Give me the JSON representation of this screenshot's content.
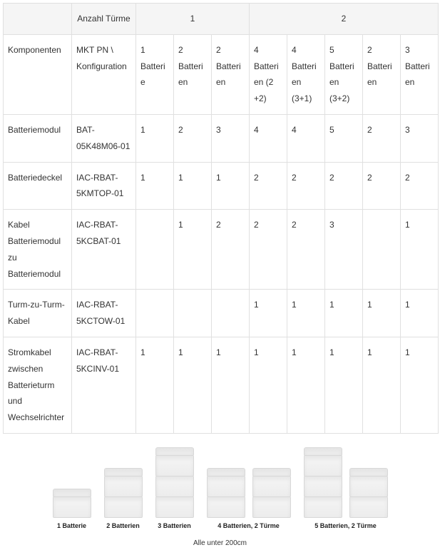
{
  "header": {
    "towers_label": "Anzahl Türme",
    "group1": "1",
    "group2": "2"
  },
  "col_labels": {
    "c0": "Komponenten",
    "c1": "MKT PN \\ Konfiguration",
    "c2": "1 Batterie",
    "c3": "2 Batterien",
    "c4": "2 Batterien",
    "c5": "4 Batterien (2 +2)",
    "c6": "4 Batterien (3+1)",
    "c7": "5 Batterien (3+2)",
    "c8": "2 Batterien",
    "c9": "3 Batterien"
  },
  "rows": [
    {
      "label": "Batteriemodul",
      "mkt": "BAT-05K48M06-01",
      "v": [
        "1",
        "2",
        "3",
        "4",
        "4",
        "5",
        "2",
        "3"
      ]
    },
    {
      "label": "Batteriedeckel",
      "mkt": "IAC-RBAT-5KMTOP-01",
      "v": [
        "1",
        "1",
        "1",
        "2",
        "2",
        "2",
        "2",
        "2"
      ]
    },
    {
      "label": "Kabel Batteriemodul zu Batteriemodul",
      "mkt": "IAC-RBAT-5KCBAT-01",
      "v": [
        "",
        "1",
        "2",
        "2",
        "2",
        "3",
        "",
        "1"
      ]
    },
    {
      "label": "Turm-zu-Turm-Kabel",
      "mkt": "IAC-RBAT-5KCTOW-01",
      "v": [
        "",
        "",
        "",
        "1",
        "1",
        "1",
        "1",
        "1"
      ]
    },
    {
      "label": "Stromkabel zwischen Batterieturm und Wechselrichter",
      "mkt": "IAC-RBAT-5KCINV-01",
      "v": [
        "1",
        "1",
        "1",
        "1",
        "1",
        "1",
        "1",
        "1"
      ]
    }
  ],
  "illustration": {
    "configs": [
      {
        "label": "1 Batterie"
      },
      {
        "label": "2 Batterien"
      },
      {
        "label": "3 Batterien"
      },
      {
        "label": "4 Batterien, 2 Türme"
      },
      {
        "label": "5 Batterien, 2 Türme"
      }
    ],
    "footer": "Alle unter 200cm"
  },
  "chart_data": {
    "type": "table",
    "title": "",
    "columns": [
      "Komponenten",
      "MKT PN \\ Konfiguration",
      "1 Batterie",
      "2 Batterien",
      "2 Batterien",
      "4 Batterien (2 +2)",
      "4 Batterien (3+1)",
      "5 Batterien (3+2)",
      "2 Batterien",
      "3 Batterien"
    ],
    "tower_group_for_column": [
      null,
      null,
      1,
      1,
      1,
      2,
      2,
      2,
      2,
      2
    ],
    "rows": [
      [
        "Batteriemodul",
        "BAT-05K48M06-01",
        1,
        2,
        3,
        4,
        4,
        5,
        2,
        3
      ],
      [
        "Batteriedeckel",
        "IAC-RBAT-5KMTOP-01",
        1,
        1,
        1,
        2,
        2,
        2,
        2,
        2
      ],
      [
        "Kabel Batteriemodul zu Batteriemodul",
        "IAC-RBAT-5KCBAT-01",
        null,
        1,
        2,
        2,
        2,
        3,
        null,
        1
      ],
      [
        "Turm-zu-Turm-Kabel",
        "IAC-RBAT-5KCTOW-01",
        null,
        null,
        null,
        1,
        1,
        1,
        1,
        1
      ],
      [
        "Stromkabel zwischen Batterieturm und Wechselrichter",
        "IAC-RBAT-5KCINV-01",
        1,
        1,
        1,
        1,
        1,
        1,
        1,
        1
      ]
    ]
  }
}
